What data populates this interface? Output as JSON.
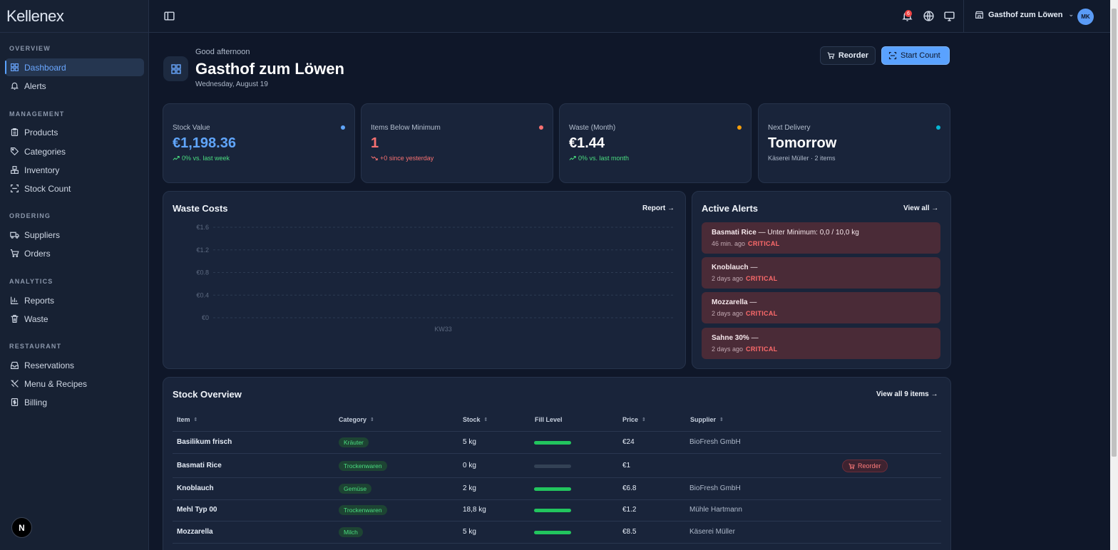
{
  "app": {
    "logo": "Kellenex"
  },
  "sidebar": {
    "sections": [
      {
        "label": "OVERVIEW"
      },
      {
        "label": "MANAGEMENT"
      },
      {
        "label": "ORDERING"
      },
      {
        "label": "ANALYTICS"
      },
      {
        "label": "RESTAURANT"
      }
    ],
    "items": [
      {
        "label": "Dashboard",
        "icon": "grid-icon"
      },
      {
        "label": "Alerts",
        "icon": "bell-icon"
      },
      {
        "label": "Products",
        "icon": "clipboard-icon"
      },
      {
        "label": "Categories",
        "icon": "tag-icon"
      },
      {
        "label": "Inventory",
        "icon": "boxes-icon"
      },
      {
        "label": "Stock Count",
        "icon": "scan-icon"
      },
      {
        "label": "Suppliers",
        "icon": "truck-icon"
      },
      {
        "label": "Orders",
        "icon": "cart-icon"
      },
      {
        "label": "Reports",
        "icon": "bar-chart-icon"
      },
      {
        "label": "Waste",
        "icon": "trash-icon"
      },
      {
        "label": "Reservations",
        "icon": "inbox-icon"
      },
      {
        "label": "Menu & Recipes",
        "icon": "utensils-icon"
      },
      {
        "label": "Billing",
        "icon": "receipt-icon"
      }
    ],
    "bottom_badge": "N"
  },
  "topbar": {
    "notification_count": "6",
    "restaurant": "Gasthof zum Löwen",
    "avatar_initials": "MK"
  },
  "header": {
    "greeting": "Good afternoon",
    "title": "Gasthof zum Löwen",
    "date": "Wednesday, August 19",
    "reorder_label": "Reorder",
    "start_count_label": "Start Count"
  },
  "kpis": [
    {
      "label": "Stock Value",
      "value": "€1,198.36",
      "sub": "0% vs. last week",
      "color": "#60a5fa",
      "sub_color": "#4ade80"
    },
    {
      "label": "Items Below Minimum",
      "value": "1",
      "sub": "+0 since yesterday",
      "color": "#f87171",
      "sub_color": "#f87171"
    },
    {
      "label": "Waste (Month)",
      "value": "€1.44",
      "sub": "0% vs. last month",
      "color": "#f59e0b",
      "sub_color": "#4ade80"
    },
    {
      "label": "Next Delivery",
      "value": "Tomorrow",
      "sub": "Käserei Müller · 2 items",
      "color": "#06b6d4",
      "sub_color": "#aeb9ca"
    }
  ],
  "waste_costs": {
    "title": "Waste Costs",
    "link": "Report →"
  },
  "chart_data": {
    "type": "bar",
    "categories": [
      "KW33"
    ],
    "values": [
      0
    ],
    "title": "Waste Costs",
    "xlabel": "",
    "ylabel": "",
    "ylim": [
      0,
      1.6
    ],
    "yticks": [
      "€0",
      "€0.4",
      "€0.8",
      "€1.2",
      "€1.6"
    ],
    "grid": true
  },
  "alerts": {
    "title": "Active Alerts",
    "link": "View all →",
    "items": [
      {
        "name": "Basmati Rice",
        "detail": " — Unter Minimum: 0,0 / 10,0 kg",
        "time": "46 min. ago",
        "level": "CRITICAL"
      },
      {
        "name": "Knoblauch",
        "detail": " —",
        "time": "2 days ago",
        "level": "CRITICAL"
      },
      {
        "name": "Mozzarella",
        "detail": " —",
        "time": "2 days ago",
        "level": "CRITICAL"
      },
      {
        "name": "Sahne 30%",
        "detail": " —",
        "time": "2 days ago",
        "level": "CRITICAL"
      }
    ]
  },
  "stock": {
    "title": "Stock Overview",
    "link": "View all 9 items →",
    "columns": [
      "Item",
      "Category",
      "Stock",
      "Fill Level",
      "Price",
      "Supplier"
    ],
    "reorder_label": "Reorder",
    "rows": [
      {
        "item": "Basilikum frisch",
        "category": "Kräuter",
        "stock": "5 kg",
        "fill": 1.0,
        "price": "€24",
        "supplier": "BioFresh GmbH"
      },
      {
        "item": "Basmati Rice",
        "category": "Trockenwaren",
        "stock": "0 kg",
        "fill": 0.0,
        "price": "€1",
        "supplier": ""
      },
      {
        "item": "Knoblauch",
        "category": "Gemüse",
        "stock": "2 kg",
        "fill": 1.0,
        "price": "€6.8",
        "supplier": "BioFresh GmbH"
      },
      {
        "item": "Mehl Typ 00",
        "category": "Trockenwaren",
        "stock": "18,8 kg",
        "fill": 1.0,
        "price": "€1.2",
        "supplier": "Mühle Hartmann"
      },
      {
        "item": "Mozzarella",
        "category": "Milch",
        "stock": "5 kg",
        "fill": 1.0,
        "price": "€8.5",
        "supplier": "Käserei Müller"
      }
    ]
  }
}
